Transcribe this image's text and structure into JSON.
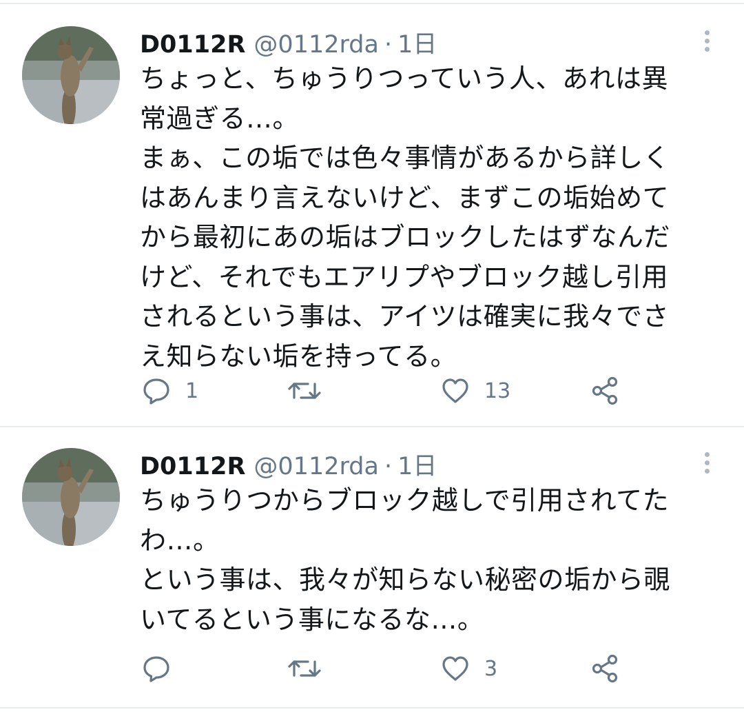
{
  "tweets": [
    {
      "display_name": "D0112R",
      "handle": "@0112rda",
      "separator": "·",
      "time": "1日",
      "text_lines": [
        "ちょっと、ちゅうりつっていう人、あれは異",
        "常過ぎる…。",
        "まぁ、この垢では色々事情があるから詳しく",
        "はあんまり言えないけど、まずこの垢始めて",
        "から最初にあの垢はブロックしたはずなんだ",
        "けど、それでもエアリプやブロック越し引用",
        "されるという事は、アイツは確実に我々でさ",
        "え知らない垢を持ってる。"
      ],
      "replies": "1",
      "retweets": "",
      "likes": "13"
    },
    {
      "display_name": "D0112R",
      "handle": "@0112rda",
      "separator": "·",
      "time": "1日",
      "text_lines": [
        "ちゅうりつからブロック越しで引用されてた",
        "わ…。",
        "という事は、我々が知らない秘密の垢から覗",
        "いてるという事になるな…。"
      ],
      "replies": "",
      "retweets": "",
      "likes": "3"
    }
  ],
  "icons": {
    "avatar": "cat-photo-avatar",
    "more": "more-vertical-icon",
    "reply": "reply-icon",
    "retweet": "retweet-icon",
    "like": "heart-icon",
    "share": "share-icon"
  },
  "colors": {
    "text": "#14171a",
    "secondary": "#657786",
    "icon": "#657786",
    "divider": "#e6ecf0",
    "menu_dots": "#aab8c2"
  }
}
